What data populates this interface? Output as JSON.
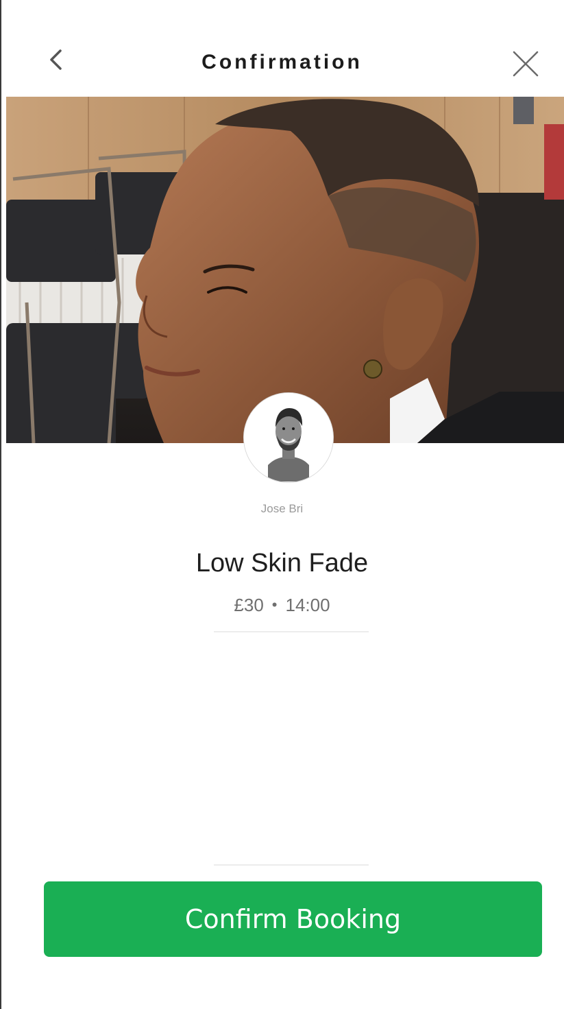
{
  "header": {
    "title": "Confirmation",
    "back_icon": "chevron-left-icon",
    "close_icon": "close-icon"
  },
  "hero": {
    "image": "barber-haircut-photo"
  },
  "barber": {
    "name": "Jose Bri",
    "avatar": "barber-avatar-photo"
  },
  "service": {
    "name": "Low Skin Fade",
    "price": "£30",
    "separator": "•",
    "time": "14:00"
  },
  "actions": {
    "confirm_label": "Confirm Booking"
  },
  "colors": {
    "accent": "#1aaf54",
    "title_text": "#1c1c1c",
    "muted_text": "#9a9a9a",
    "meta_text": "#6f6f6f",
    "divider": "#ececec"
  }
}
